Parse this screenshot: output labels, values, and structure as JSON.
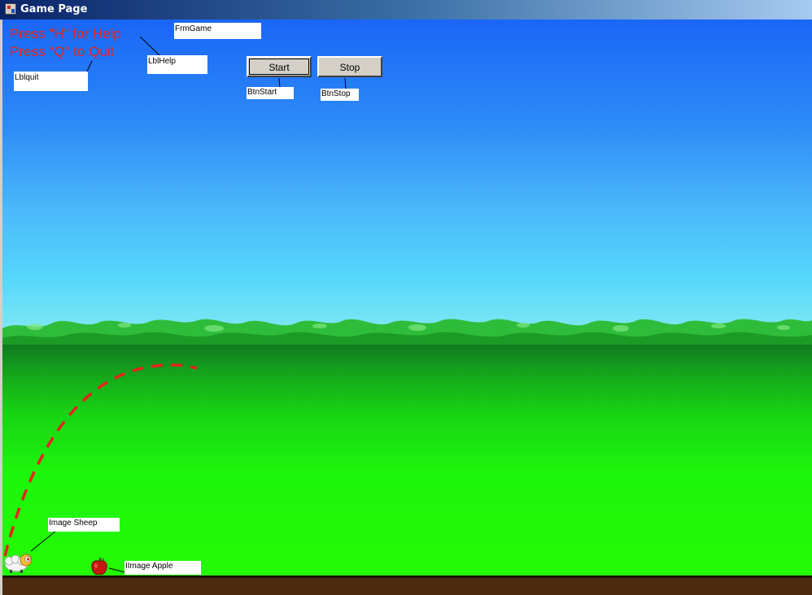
{
  "window": {
    "title": "Game Page",
    "app_icon": "winforms-app-icon"
  },
  "help": {
    "help_line": "Press \"H\" for Help",
    "quit_line": "Press \"Q\" to Quit"
  },
  "designer_labels": {
    "form": "FrmGame",
    "help": "LblHelp",
    "quit": "Lblquit",
    "btn_start": "BtnStart",
    "btn_stop": "BtnStop",
    "sheep": "Image Sheep",
    "apple": "IImage Apple"
  },
  "buttons": {
    "start": "Start",
    "stop": "Stop"
  },
  "colors": {
    "help_text": "#e8221a",
    "trajectory": "#e8221a",
    "sky_top": "#1a66f7",
    "grass": "#24fb05",
    "dirt": "#4b2a0f"
  },
  "sprites": {
    "sheep": "sheep-icon",
    "apple": "apple-icon"
  }
}
